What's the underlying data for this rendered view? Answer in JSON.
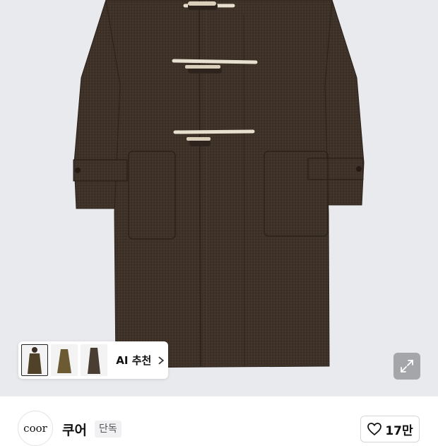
{
  "product_image": {
    "alt_subject": "coat",
    "background_color": "#e9eaee",
    "coat_color": "#3d3128",
    "toggle_color": "#ebe4d4"
  },
  "ai_recommend": {
    "label": "AI 추천",
    "thumbnails": [
      {
        "icon": "dark-coat-model-thumbnail",
        "selected": true
      },
      {
        "icon": "olive-coat-thumbnail",
        "selected": false
      },
      {
        "icon": "brown-coat-thumbnail",
        "selected": false
      }
    ],
    "chevron_icon": "chevron-right-icon"
  },
  "expand_button": {
    "icon": "expand-icon"
  },
  "store": {
    "logo_text": "coor",
    "name": "쿠어",
    "badge": "단독",
    "like_icon": "heart-outline-icon",
    "like_count": "17만"
  }
}
